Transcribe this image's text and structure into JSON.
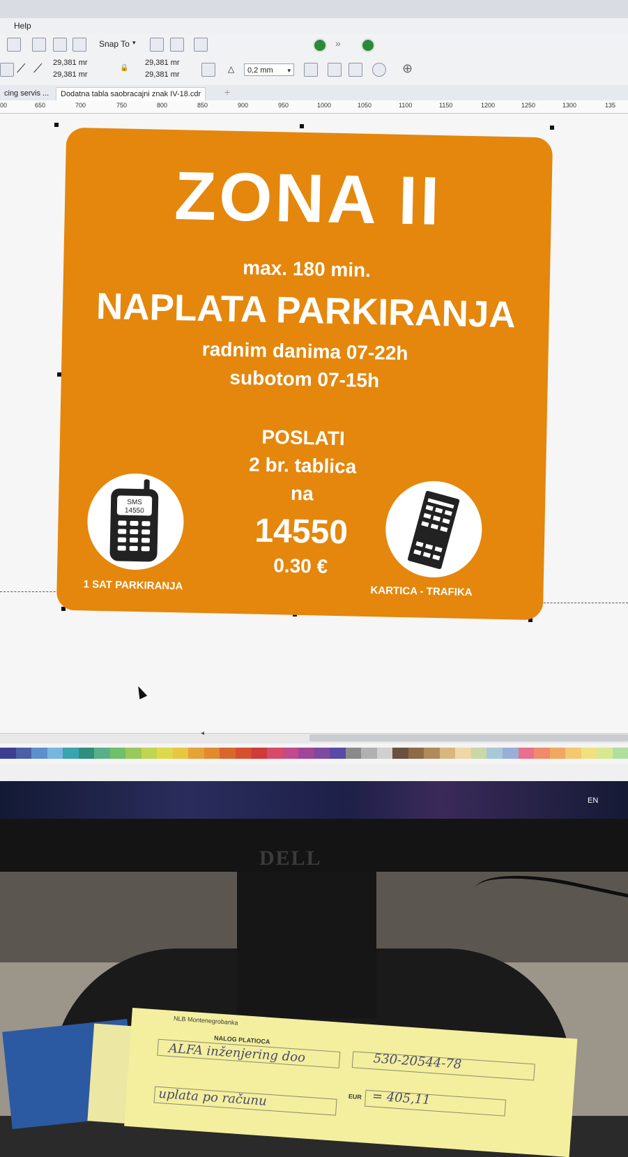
{
  "app": {
    "menu": {
      "help_label": "Help"
    },
    "toolbar": {
      "snap_label": "Snap To",
      "width_top": "29,381 mr",
      "width_bottom": "29,381 mr",
      "height_top": "29,381 mr",
      "height_bottom": "29,381 mr",
      "outline_value": "0,2 mm"
    },
    "tabs": [
      "cing servis ...",
      "Dodatna tabla saobracajni znak IV-18.cdr"
    ],
    "tab_add": "+",
    "ruler_ticks": [
      "00",
      "650",
      "700",
      "750",
      "800",
      "850",
      "900",
      "950",
      "1000",
      "1050",
      "1100",
      "1150",
      "1200",
      "1250",
      "1300",
      "135"
    ],
    "taskbar_lang": "EN"
  },
  "sign": {
    "title": "ZONA  II",
    "max_time": "max. 180 min.",
    "headline": "NAPLATA  PARKIRANJA",
    "hours_weekday": "radnim  danima 07-22h",
    "hours_saturday": "subotom 07-15h",
    "send_line1": "POSLATI",
    "send_line2": "2 br. tablica",
    "send_line3": "na",
    "sms_number": "14550",
    "price": "0.30 €",
    "phone_screen_top": "SMS",
    "phone_screen_bottom": "14550",
    "caption_left": "1 SAT PARKIRANJA",
    "caption_right": "KARTICA - TRAFIKA"
  },
  "hardware": {
    "monitor_brand": "DELL"
  },
  "paper": {
    "bank": "NLB Montenegrobanka",
    "form_title": "NALOG PLATIOCA",
    "payer_handwritten": "ALFA  inženjering doo",
    "purpose_handwritten": "uplata  po  računu",
    "account_handwritten": "530-20544-78",
    "currency": "EUR",
    "amount_handwritten": "= 405,11"
  },
  "palette_colors": [
    "#3c3f8f",
    "#4a5fa8",
    "#5d8fcf",
    "#78b5e0",
    "#3aa3b0",
    "#2f8f7c",
    "#58b08b",
    "#6fc06a",
    "#9bc85a",
    "#c0d64e",
    "#dcd94a",
    "#e8c640",
    "#e6a235",
    "#e38a2e",
    "#d9672c",
    "#d6502f",
    "#cf3a3a",
    "#d84a6a",
    "#c24a8a",
    "#a04598",
    "#7d4aa0",
    "#5a4aa5",
    "#8a8a8a",
    "#b0b0b0",
    "#d0d0d0",
    "#6a5140",
    "#8e6a45",
    "#b08a5a",
    "#d8b680",
    "#efd7a8",
    "#c8d8a8",
    "#a8c8d8",
    "#98b0d8",
    "#e86f8f",
    "#f08a6a",
    "#f0a860",
    "#f4c870",
    "#f0e080",
    "#d8e890",
    "#b0e0a0"
  ]
}
